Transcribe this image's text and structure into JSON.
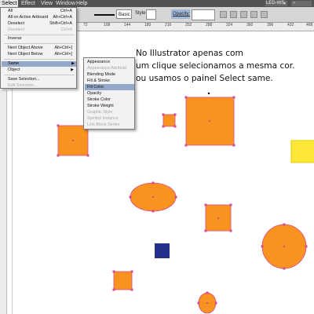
{
  "app": {
    "menu": [
      "Select",
      "Effect",
      "View",
      "Window",
      "Help"
    ],
    "workspace": "LED-WS"
  },
  "control_bar": {
    "brush_preset": "Basic",
    "style_label": "Style:",
    "opacity_label": "Opacity:"
  },
  "ruler_ticks": [
    "72",
    "108",
    "144",
    "180",
    "216",
    "252",
    "288",
    "324",
    "360",
    "396",
    "432",
    "468"
  ],
  "select_menu": {
    "items": [
      {
        "label": "All",
        "shortcut": "Ctrl+A",
        "state": "normal"
      },
      {
        "label": "All on Active Artboard",
        "shortcut": "Alt+Ctrl+A",
        "state": "normal"
      },
      {
        "label": "Deselect",
        "shortcut": "Shift+Ctrl+A",
        "state": "normal"
      },
      {
        "label": "Reselect",
        "shortcut": "Ctrl+6",
        "state": "disabled"
      },
      {
        "label": "Inverse",
        "shortcut": "",
        "state": "normal"
      },
      {
        "label": "Next Object Above",
        "shortcut": "Alt+Ctrl+]",
        "state": "normal"
      },
      {
        "label": "Next Object Below",
        "shortcut": "Alt+Ctrl+[",
        "state": "normal"
      },
      {
        "label": "Same",
        "shortcut": "",
        "state": "highlighted"
      },
      {
        "label": "Object",
        "shortcut": "",
        "state": "normal"
      },
      {
        "label": "Save Selection...",
        "shortcut": "",
        "state": "normal"
      },
      {
        "label": "Edit Selection...",
        "shortcut": "",
        "state": "disabled"
      }
    ]
  },
  "same_submenu": {
    "items": [
      {
        "label": "Appearance",
        "state": "normal"
      },
      {
        "label": "Appearance Attribute",
        "state": "disabled"
      },
      {
        "label": "Blending Mode",
        "state": "normal"
      },
      {
        "label": "Fill & Stroke",
        "state": "normal"
      },
      {
        "label": "Fill Color",
        "state": "highlighted"
      },
      {
        "label": "Opacity",
        "state": "normal"
      },
      {
        "label": "Stroke Color",
        "state": "normal"
      },
      {
        "label": "Stroke Weight",
        "state": "normal"
      },
      {
        "label": "Graphic Style",
        "state": "disabled"
      },
      {
        "label": "Symbol Instance",
        "state": "disabled"
      },
      {
        "label": "Link Block Series",
        "state": "disabled"
      }
    ]
  },
  "caption": {
    "line1": "No Illustrator apenas com",
    "line2": "um clique selecionamos a mesma cor.",
    "line3": "ou usamos o painel Select same."
  },
  "colors": {
    "orange_fill": "#f7931e",
    "selection": "#d84b94",
    "blue": "#262f8a",
    "yellow": "#fde736",
    "menu_highlight": "#93a8c8"
  }
}
